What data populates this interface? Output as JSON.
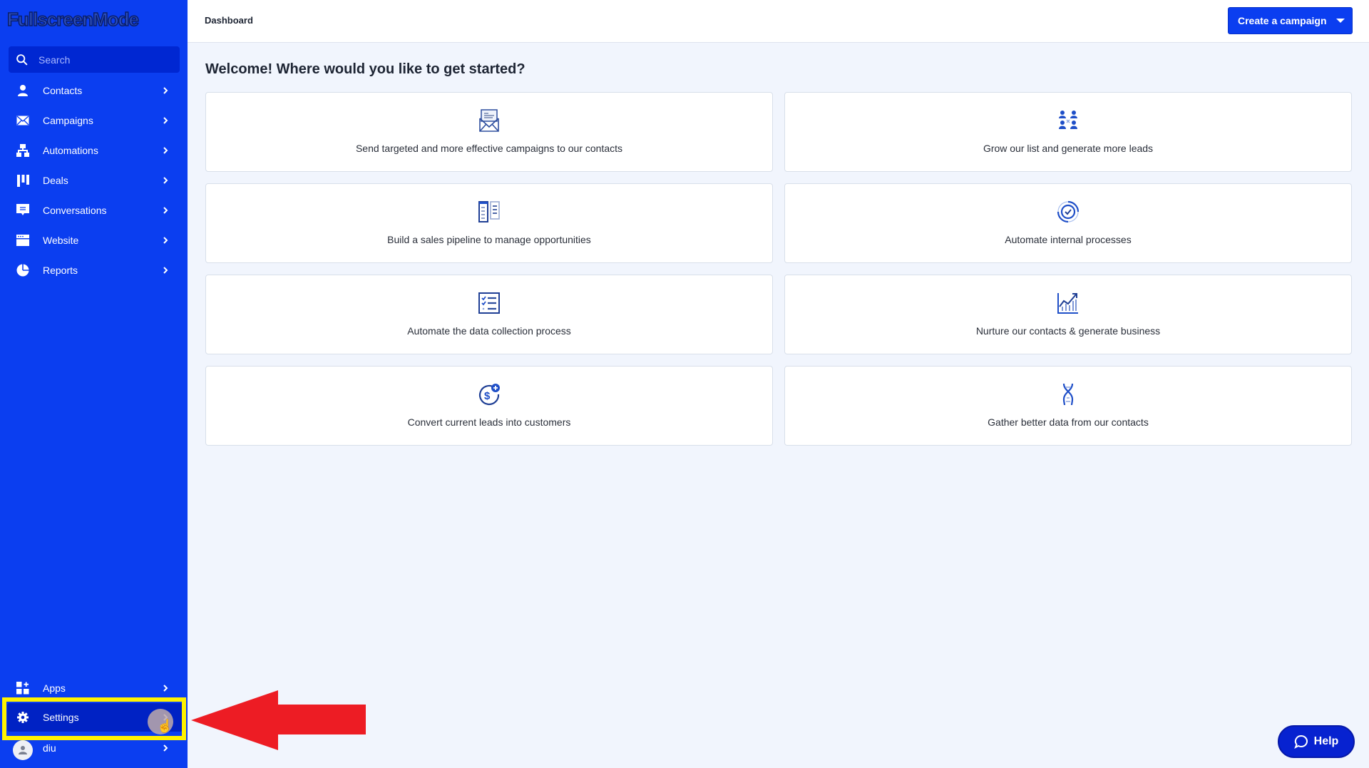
{
  "app": {
    "logo_text": "FullscreenMode"
  },
  "sidebar": {
    "search": {
      "placeholder": "Search",
      "value": ""
    },
    "items": [
      {
        "label": "Contacts",
        "icon": "person-icon"
      },
      {
        "label": "Campaigns",
        "icon": "envelope-icon"
      },
      {
        "label": "Automations",
        "icon": "hierarchy-icon"
      },
      {
        "label": "Deals",
        "icon": "kanban-icon"
      },
      {
        "label": "Conversations",
        "icon": "chat-icon"
      },
      {
        "label": "Website",
        "icon": "browser-icon"
      },
      {
        "label": "Reports",
        "icon": "pie-chart-icon"
      }
    ],
    "bottom_items": [
      {
        "label": "Apps",
        "icon": "apps-grid-icon"
      },
      {
        "label": "Settings",
        "icon": "gear-icon",
        "active": true
      },
      {
        "label": "diu",
        "icon": "avatar"
      }
    ]
  },
  "header": {
    "breadcrumb": "Dashboard",
    "create_button": "Create a campaign"
  },
  "main": {
    "welcome": "Welcome! Where would you like to get started?",
    "cards": [
      {
        "label": "Send targeted and more effective campaigns to our contacts",
        "icon": "open-envelope-icon"
      },
      {
        "label": "Grow our list and generate more leads",
        "icon": "people-group-icon"
      },
      {
        "label": "Build a sales pipeline to manage opportunities",
        "icon": "pipeline-columns-icon"
      },
      {
        "label": "Automate internal processes",
        "icon": "cycle-check-icon"
      },
      {
        "label": "Automate the data collection process",
        "icon": "checklist-icon"
      },
      {
        "label": "Nurture our contacts & generate business",
        "icon": "growth-chart-icon"
      },
      {
        "label": "Convert current leads into customers",
        "icon": "dollar-plus-icon"
      },
      {
        "label": "Gather better data from our contacts",
        "icon": "dna-icon"
      }
    ]
  },
  "help": {
    "label": "Help"
  },
  "annotation": {
    "highlight_color": "#fff200",
    "arrow_color": "#ed1c24"
  },
  "colors": {
    "sidebar": "#0b3ef0",
    "accent": "#0b3ef0",
    "help": "#0722d0"
  }
}
